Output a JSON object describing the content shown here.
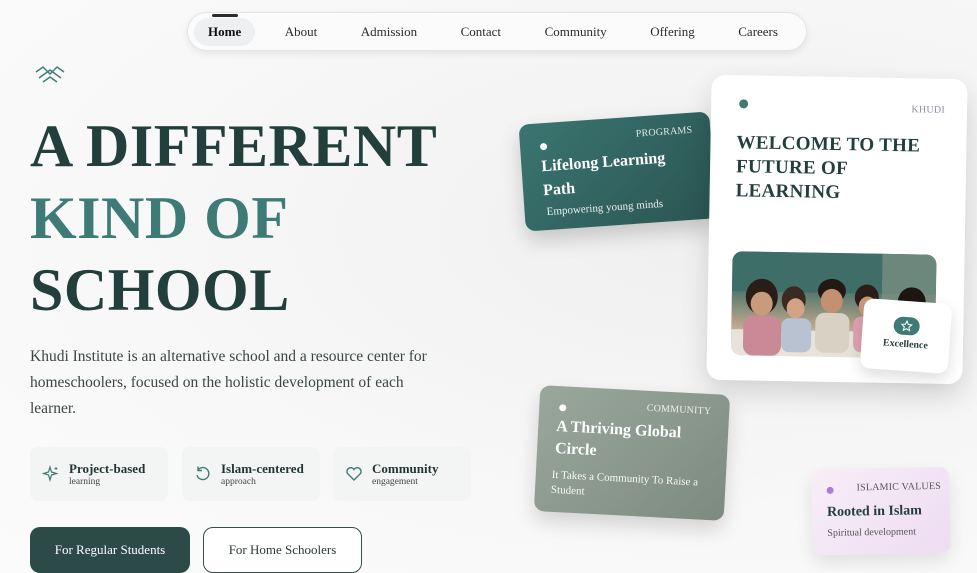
{
  "nav": {
    "items": [
      "Home",
      "About",
      "Admission",
      "Contact",
      "Community",
      "Offering",
      "Careers"
    ],
    "active": "Home"
  },
  "hero": {
    "title_line1": "A DIFFERENT",
    "title_line2": "KIND OF",
    "title_line3": "SCHOOL",
    "description": "Khudi Institute is an alternative school and a resource center for homeschoolers, focused on the holistic development of each learner."
  },
  "features": [
    {
      "title": "Project-based",
      "subtitle": "learning",
      "icon": "sparkle-icon"
    },
    {
      "title": "Islam-centered",
      "subtitle": "approach",
      "icon": "refresh-icon"
    },
    {
      "title": "Community",
      "subtitle": "engagement",
      "icon": "heart-icon"
    }
  ],
  "buttons": {
    "primary": "For Regular Students",
    "secondary": "For Home Schoolers"
  },
  "cards": {
    "programs": {
      "tag": "PROGRAMS",
      "title": "Lifelong Learning Path",
      "subtitle": "Empowering young minds"
    },
    "welcome": {
      "tag": "KHUDI",
      "title": "WELCOME TO THE FUTURE OF LEARNING",
      "badge": "Excellence"
    },
    "community": {
      "tag": "COMMUNITY",
      "title": "A Thriving Global Circle",
      "subtitle": "It Takes a Community To Raise a Student"
    },
    "islamic": {
      "tag": "ISLAMIC VALUES",
      "title": "Rooted in Islam",
      "subtitle": "Spiritual development"
    }
  },
  "colors": {
    "brand_dark": "#223f3c",
    "brand_teal": "#3e7b76",
    "button_dark": "#2c4a48"
  }
}
